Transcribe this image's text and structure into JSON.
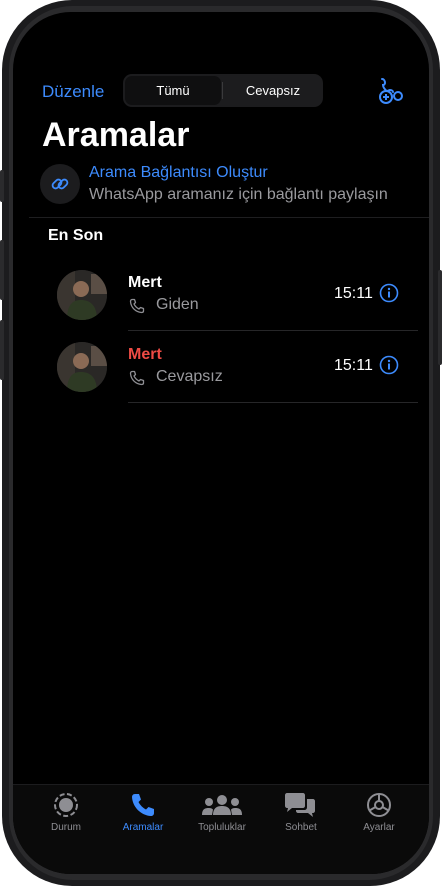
{
  "header": {
    "edit_label": "Düzenle",
    "segments": [
      "Tümü",
      "Cevapsız"
    ],
    "active_segment": "Tümü",
    "title": "Aramalar"
  },
  "call_link": {
    "title": "Arama Bağlantısı Oluştur",
    "subtitle": "WhatsApp aramanız için bağlantı paylaşın"
  },
  "section_title": "En Son",
  "calls": [
    {
      "name": "Mert",
      "type": "Giden",
      "time": "15:11",
      "missed": false
    },
    {
      "name": "Mert",
      "type": "Cevapsız",
      "time": "15:11",
      "missed": true
    }
  ],
  "tabs": [
    {
      "label": "Durum",
      "icon": "status-icon"
    },
    {
      "label": "Aramalar",
      "icon": "phone-icon",
      "active": true
    },
    {
      "label": "Topluluklar",
      "icon": "communities-icon"
    },
    {
      "label": "Sohbet",
      "icon": "chats-icon"
    },
    {
      "label": "Ayarlar",
      "icon": "gear-icon"
    }
  ],
  "colors": {
    "accent": "#3d8bfd",
    "missed": "#ee4b44",
    "background": "#000000"
  }
}
